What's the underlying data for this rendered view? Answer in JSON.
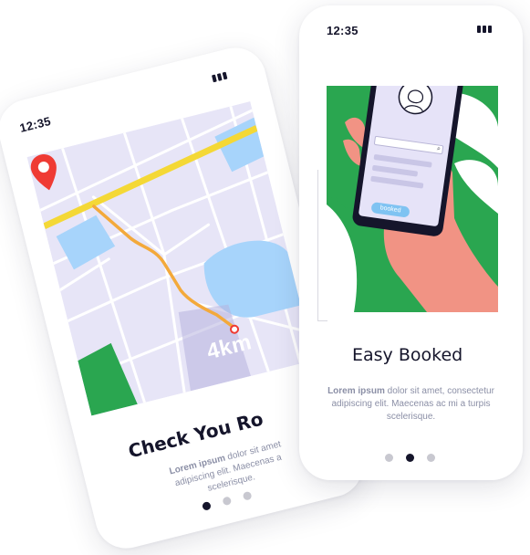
{
  "colors": {
    "primary_dark": "#15152b",
    "accent_green": "#2aa650",
    "accent_blue": "#a7d4fb",
    "route_orange": "#f3a93b",
    "road_yellow": "#f4d836",
    "pin_red": "#ef3b34",
    "hand_pink": "#f19384",
    "muted_text": "#8b8fa6"
  },
  "screens": [
    {
      "status": {
        "time": "12:35",
        "battery_icon": "battery-icon"
      },
      "map": {
        "distance": "4km",
        "pin_icon": "location-pin-icon"
      },
      "title": "Check You Ro",
      "description": {
        "lead": "Lorem ipsum",
        "line1_rest": " dolor sit amet",
        "line2": "adipiscing elit. Maecenas a",
        "line3": "scelerisque."
      },
      "pagination": {
        "count": 3,
        "active_index": 0
      }
    },
    {
      "status": {
        "time": "12:35",
        "battery_icon": "battery-icon"
      },
      "illustration": {
        "button_label": "booked",
        "search_icon": "search-icon",
        "avatar_icon": "user-avatar-icon"
      },
      "title": "Easy Booked",
      "description": {
        "lead": "Lorem ipsum",
        "line1_rest": " dolor sit amet, consectetur",
        "line2": "adipiscing elit. Maecenas ac mi a turpis",
        "line3": "scelerisque."
      },
      "pagination": {
        "count": 3,
        "active_index": 1
      }
    }
  ]
}
